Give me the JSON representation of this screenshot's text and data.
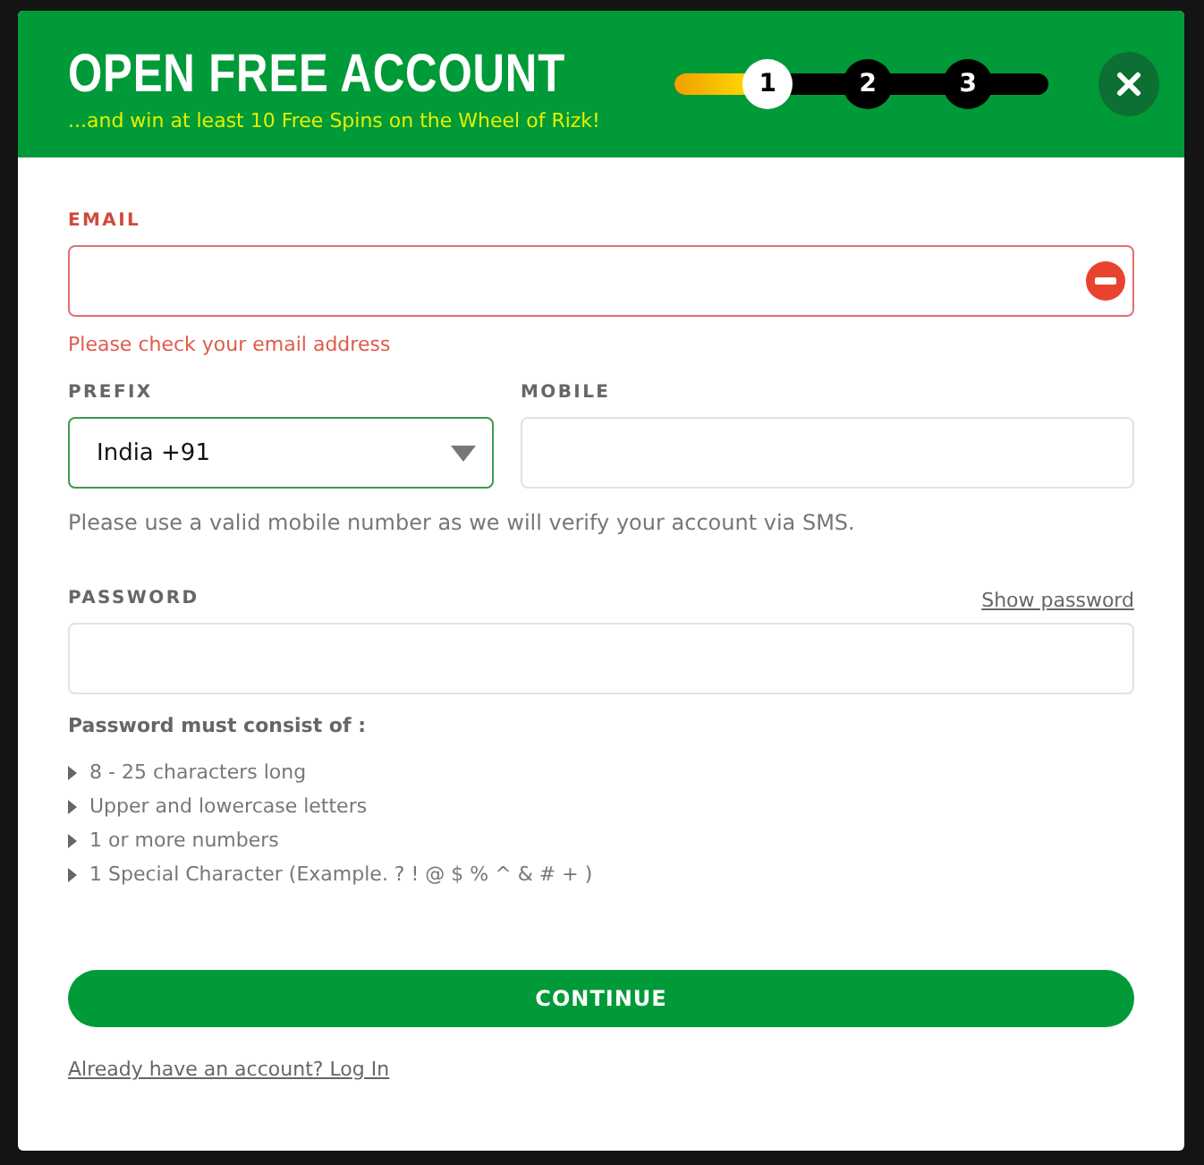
{
  "header": {
    "title": "OPEN FREE ACCOUNT",
    "subtitle": "...and win at least 10 Free Spins on the Wheel of Rizk!",
    "progress": {
      "level": 0.23
    },
    "steps": [
      {
        "label": "1",
        "selected": true
      },
      {
        "label": "2",
        "selected": false
      },
      {
        "label": "3",
        "selected": false
      }
    ]
  },
  "email": {
    "label": "EMAIL",
    "error": true,
    "message": "Please check your email address"
  },
  "prefix": {
    "label": "PREFIX",
    "value": "India +91",
    "focused": true
  },
  "mobile": {
    "label": "MOBILE",
    "hint": "Please use a valid mobile number as we will verify your account via SMS."
  },
  "password": {
    "label": "PASSWORD",
    "toggle": "Show password",
    "rules_title": "Password must consist of :",
    "rules": [
      "8 - 25 characters long",
      "Upper and lowercase letters",
      "1 or more numbers",
      "1 Special Character (Example. ? ! @ $ % ^ & # + )"
    ]
  },
  "continue_button": "CONTINUE",
  "login_link": "Already have an account? Log In"
}
